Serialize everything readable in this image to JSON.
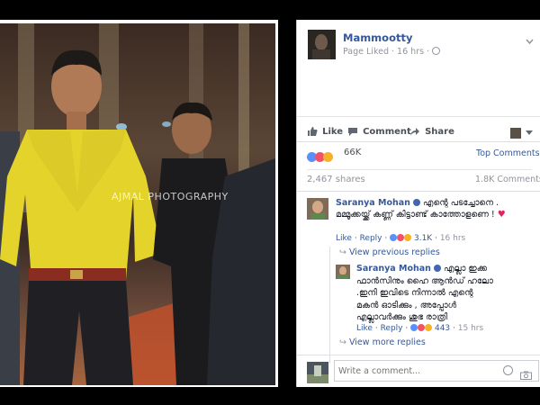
{
  "photo": {
    "watermark": "AJMAL PHOTOGRAPHY"
  },
  "post": {
    "page_name": "Mammootty",
    "meta": "Page Liked · 16 hrs ·",
    "actions": {
      "like": "Like",
      "comment": "Comment",
      "share": "Share"
    },
    "reactions_count": "66K",
    "top_comments": "Top Comments",
    "shares": "2,467 shares",
    "comments_count": "1.8K Comments"
  },
  "comments": [
    {
      "author": "Saranya Mohan",
      "text": "എന്റെ പടച്ചോനെ . മമ്മൂക്കയ്ക്ക് കണ്ണ് കിട്ടാണ്ട് കാത്തോളണെ !",
      "like": "Like",
      "reply": "Reply",
      "reaction_count": "3.1K",
      "time": "16 hrs"
    }
  ],
  "view_previous": "View previous replies",
  "reply": {
    "author": "Saranya Mohan",
    "text_lines": [
      "എല്ലാ ഇക്ക",
      "ഫാൻസിനും ഹൈ ആൻഡ് ഹലോ",
      ".ഇനി ഇവിടെ നിന്നാൽ എന്റെ",
      "മകൻ ഓടിക്കും , അപ്പോൾ",
      "എല്ലാവർക്കും ശുഭ രാത്രി"
    ],
    "like": "Like",
    "reply": "Reply",
    "reaction_count": "443",
    "time": "15 hrs"
  },
  "view_more": "View more replies",
  "composer": {
    "placeholder": "Write a comment..."
  },
  "colors": {
    "link": "#365899",
    "like_blue": "#5890ff",
    "love_red": "#f25268",
    "haha_yellow": "#f7b125"
  }
}
